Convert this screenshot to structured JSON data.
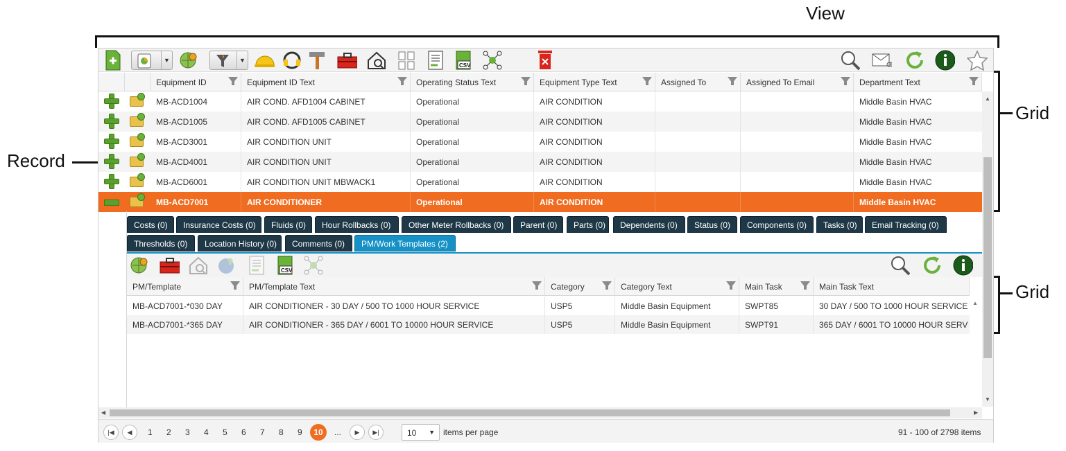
{
  "annotations": {
    "view": "View",
    "grid_top": "Grid",
    "grid_bottom": "Grid",
    "record": "Record"
  },
  "toolbar": {
    "icons": [
      "new-record-icon",
      "layout-dropdown-icon",
      "map-pin-icon",
      "filter-dropdown-icon",
      "hard-hat-icon",
      "headset-icon",
      "hammer-icon",
      "toolbox-icon",
      "house-search-icon",
      "copy-icon",
      "report-icon",
      "csv-icon",
      "network-icon",
      "delete-icon",
      "search-icon",
      "email-icon",
      "refresh-icon",
      "info-icon",
      "favorite-star-icon"
    ],
    "csv_label": "CSV"
  },
  "main_grid": {
    "columns": [
      "",
      "",
      "Equipment ID",
      "Equipment ID Text",
      "Operating Status Text",
      "Equipment Type Text",
      "Assigned To",
      "Assigned To Email",
      "Department Text"
    ],
    "rows": [
      {
        "equipment_id": "MB-ACD1004",
        "text": "AIR COND. AFD1004 CABINET",
        "status": "Operational",
        "type": "AIR CONDITION",
        "assigned_to": "",
        "email": "",
        "dept": "Middle Basin HVAC",
        "selected": false
      },
      {
        "equipment_id": "MB-ACD1005",
        "text": "AIR COND. AFD1005 CABINET",
        "status": "Operational",
        "type": "AIR CONDITION",
        "assigned_to": "",
        "email": "",
        "dept": "Middle Basin HVAC",
        "selected": false
      },
      {
        "equipment_id": "MB-ACD3001",
        "text": "AIR CONDITION UNIT",
        "status": "Operational",
        "type": "AIR CONDITION",
        "assigned_to": "",
        "email": "",
        "dept": "Middle Basin HVAC",
        "selected": false
      },
      {
        "equipment_id": "MB-ACD4001",
        "text": "AIR CONDITION UNIT",
        "status": "Operational",
        "type": "AIR CONDITION",
        "assigned_to": "",
        "email": "",
        "dept": "Middle Basin HVAC",
        "selected": false
      },
      {
        "equipment_id": "MB-ACD6001",
        "text": "AIR CONDITION UNIT MBWACK1",
        "status": "Operational",
        "type": "AIR CONDITION",
        "assigned_to": "",
        "email": "",
        "dept": "Middle Basin HVAC",
        "selected": false
      },
      {
        "equipment_id": "MB-ACD7001",
        "text": "AIR CONDITIONER",
        "status": "Operational",
        "type": "AIR CONDITION",
        "assigned_to": "",
        "email": "",
        "dept": "Middle Basin HVAC",
        "selected": true
      }
    ]
  },
  "tabs_row1": [
    "Costs (0)",
    "Insurance Costs (0)",
    "Fluids (0)",
    "Hour Rollbacks (0)",
    "Other Meter Rollbacks (0)",
    "Parent (0)",
    "Parts (0)",
    "Dependents (0)",
    "Status (0)",
    "Components (0)",
    "Tasks (0)",
    "Email Tracking (0)"
  ],
  "tabs_row2": [
    "Thresholds (0)",
    "Location History (0)",
    "Comments (0)",
    "PM/Work Templates (2)"
  ],
  "active_tab": "PM/Work Templates (2)",
  "sub_toolbar": {
    "icons": [
      "map-pin-icon",
      "toolbox-icon",
      "house-search-icon",
      "web-upload-icon",
      "report-icon",
      "csv-icon",
      "network-icon",
      "search-icon",
      "refresh-icon",
      "info-icon"
    ],
    "csv_label": "CSV"
  },
  "sub_grid": {
    "columns": [
      "PM/Template",
      "PM/Template Text",
      "Category",
      "Category Text",
      "Main Task",
      "Main Task Text"
    ],
    "rows": [
      {
        "pm": "MB-ACD7001-*030 DAY",
        "pm_text": "AIR CONDITIONER - 30 DAY / 500 TO 1000 HOUR SERVICE",
        "category": "USP5",
        "category_text": "Middle Basin Equipment",
        "main_task": "SWPT85",
        "main_task_text": "30 DAY / 500 TO 1000 HOUR SERVICE"
      },
      {
        "pm": "MB-ACD7001-*365 DAY",
        "pm_text": "AIR CONDITIONER - 365 DAY / 6001 TO 10000 HOUR SERVICE",
        "category": "USP5",
        "category_text": "Middle Basin Equipment",
        "main_task": "SWPT91",
        "main_task_text": "365 DAY / 6001 TO 10000 HOUR SERV"
      }
    ]
  },
  "pager": {
    "pages": [
      "1",
      "2",
      "3",
      "4",
      "5",
      "6",
      "7",
      "8",
      "9"
    ],
    "current": "10",
    "ellipsis": "...",
    "page_size": "10",
    "per_page_label": "items per page",
    "summary": "91 - 100 of 2798 items"
  },
  "colors": {
    "accent": "#ef6c21",
    "tab_dark": "#1f3847",
    "tab_active": "#1591c6",
    "plus_green": "#5aa02c"
  }
}
